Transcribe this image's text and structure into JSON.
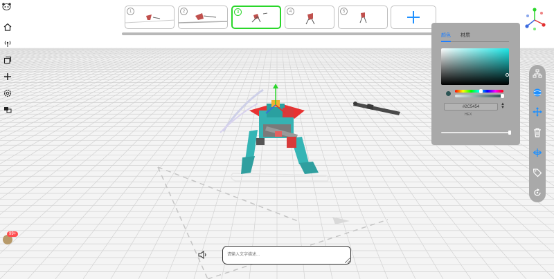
{
  "topbar": {
    "thumbnails": [
      {
        "num": "1",
        "active": false
      },
      {
        "num": "2",
        "active": false
      },
      {
        "num": "3",
        "active": true
      },
      {
        "num": "4",
        "active": false
      },
      {
        "num": "5",
        "active": false
      }
    ],
    "add_icon": "plus-icon"
  },
  "left_toolbar": {
    "items": [
      "home-icon",
      "broadcast-icon",
      "layers-icon",
      "add-icon",
      "settings-gear-icon",
      "windows-icon"
    ]
  },
  "color_panel": {
    "tabs": [
      "颜色",
      "材质"
    ],
    "active_tab": 0,
    "hex_value": "#2C5454",
    "mode_label": "HEX",
    "swatch_color": "#2C5454",
    "opacity_percent": 100
  },
  "right_toolbar": {
    "items": [
      "hierarchy-icon",
      "material-sphere-icon",
      "move-arrows-icon",
      "delete-trash-icon",
      "rotate-axis-icon",
      "tag-icon",
      "reset-icon"
    ]
  },
  "prompt": {
    "placeholder": "请输入文字描述..."
  },
  "user": {
    "badge": "99+"
  },
  "colors": {
    "active_thumb_border": "#2AD62A",
    "accent_blue": "#1E90FF",
    "panel_bg": "#A9A9A9"
  }
}
